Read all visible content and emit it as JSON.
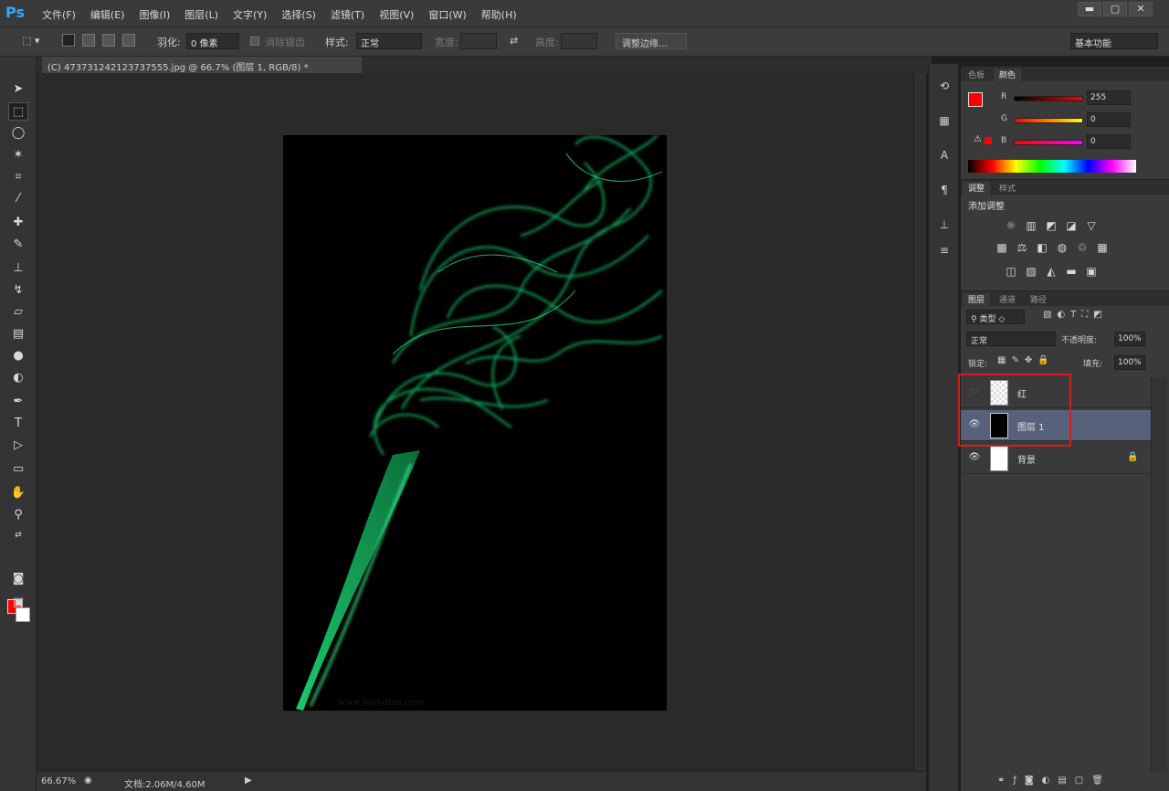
{
  "app": {
    "logo": "Ps",
    "menu": [
      "文件(F)",
      "编辑(E)",
      "图像(I)",
      "图层(L)",
      "文字(Y)",
      "选择(S)",
      "滤镜(T)",
      "视图(V)",
      "窗口(W)",
      "帮助(H)"
    ],
    "window_buttons": [
      "▬",
      "▢",
      "✕"
    ]
  },
  "options": {
    "feather_label": "羽化:",
    "feather_value": "0 像素",
    "antialias_label": "消除锯齿",
    "style_label": "样式:",
    "style_value": "正常",
    "width_label": "宽度:",
    "height_label": "高度:",
    "refine_button": "调整边缘...",
    "workspace_select": "基本功能"
  },
  "document": {
    "tab_title": "(C) 473731242123737555.jpg @ 66.7% (图层 1, RGB/8) *",
    "watermark": "www.hiphotos.com"
  },
  "status": {
    "zoom": "66.67%",
    "doc_size": "文档:2.06M/4.60M"
  },
  "color_panel": {
    "tabs": [
      "色板",
      "颜色"
    ],
    "active_tab": "颜色",
    "channels": [
      {
        "label": "R",
        "value": "255"
      },
      {
        "label": "G",
        "value": "0"
      },
      {
        "label": "B",
        "value": "0"
      }
    ],
    "fg_color": "#ff0000",
    "bg_color": "#ffffff"
  },
  "adjust_panel": {
    "tabs": [
      "调整",
      "样式"
    ],
    "active_tab": "调整",
    "title": "添加调整"
  },
  "layers_panel": {
    "tabs": [
      "图层",
      "通道",
      "路径"
    ],
    "active_tab": "图层",
    "filter_label": "类型",
    "blend_mode": "正常",
    "opacity_label": "不透明度:",
    "opacity_value": "100%",
    "lock_label": "锁定:",
    "fill_label": "填充:",
    "fill_value": "100%",
    "layers": [
      {
        "name": "红",
        "visible": false,
        "selected": false
      },
      {
        "name": "图层 1",
        "visible": true,
        "selected": true
      },
      {
        "name": "背景",
        "visible": true,
        "selected": false,
        "locked": true
      }
    ],
    "footer_icons": [
      "link-icon",
      "fx-icon",
      "mask-icon",
      "adjustment-icon",
      "folder-icon",
      "new-layer-icon",
      "trash-icon"
    ]
  }
}
